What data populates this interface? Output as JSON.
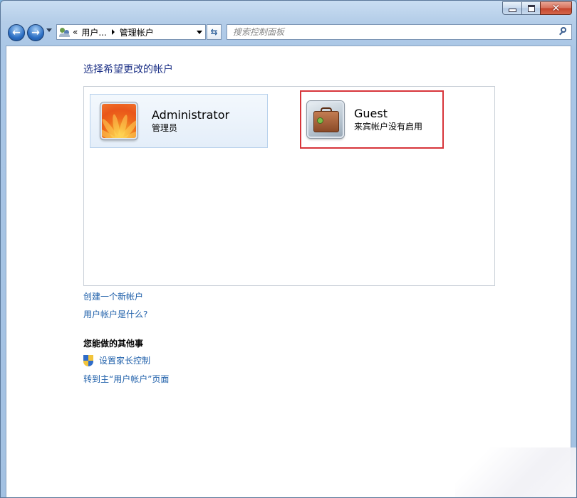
{
  "window": {
    "controls": {
      "minimize": "minimize",
      "maximize": "maximize",
      "close": "close"
    }
  },
  "navbar": {
    "address": {
      "chevrons": "«",
      "segments": [
        "用户...",
        "管理帐户"
      ]
    },
    "search_placeholder": "搜索控制面板"
  },
  "content": {
    "title": "选择希望更改的帐户",
    "accounts": [
      {
        "name": "Administrator",
        "role": "管理员",
        "avatar": "orange-flower"
      },
      {
        "name": "Guest",
        "role": "来宾帐户没有启用",
        "avatar": "suitcase",
        "highlighted": true,
        "highlight_color": "#d7353a"
      }
    ],
    "links": {
      "create": "创建一个新帐户",
      "what": "用户帐户是什么?"
    },
    "other": {
      "heading": "您能做的其他事",
      "parental": "设置家长控制",
      "home": "转到主“用户帐户”页面"
    }
  },
  "colors": {
    "link": "#1e5faa",
    "title": "#1e3287",
    "highlight": "#d7353a"
  }
}
